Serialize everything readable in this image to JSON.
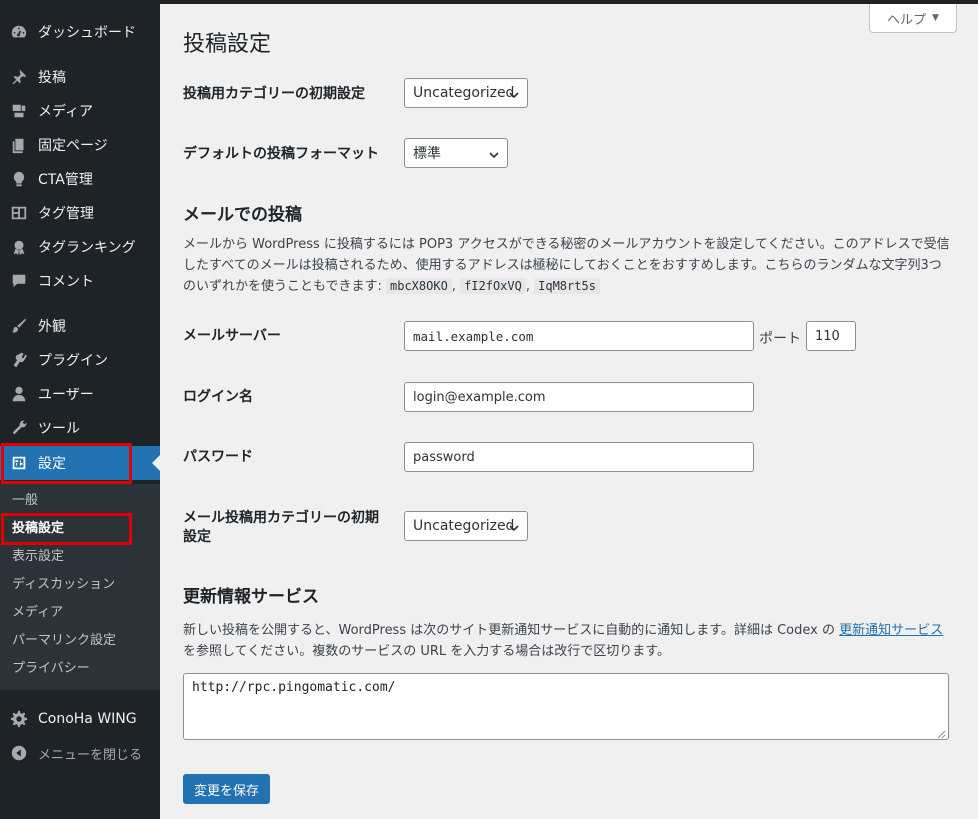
{
  "sidebar": {
    "items": [
      {
        "label": "ダッシュボード",
        "icon": "dashboard-icon"
      },
      {
        "label": "投稿",
        "icon": "pin-icon"
      },
      {
        "label": "メディア",
        "icon": "media-icon"
      },
      {
        "label": "固定ページ",
        "icon": "page-icon"
      },
      {
        "label": "CTA管理",
        "icon": "lightbulb-icon"
      },
      {
        "label": "タグ管理",
        "icon": "layout-icon"
      },
      {
        "label": "タグランキング",
        "icon": "award-icon"
      },
      {
        "label": "コメント",
        "icon": "comment-icon"
      },
      {
        "label": "外観",
        "icon": "brush-icon"
      },
      {
        "label": "プラグイン",
        "icon": "plugin-icon"
      },
      {
        "label": "ユーザー",
        "icon": "user-icon"
      },
      {
        "label": "ツール",
        "icon": "wrench-icon"
      },
      {
        "label": "設定",
        "icon": "settings-icon"
      }
    ],
    "submenu": [
      "一般",
      "投稿設定",
      "表示設定",
      "ディスカッション",
      "メディア",
      "パーマリンク設定",
      "プライバシー"
    ],
    "conoha": "ConoHa WING",
    "collapse": "メニューを閉じる"
  },
  "help": {
    "label": "ヘルプ"
  },
  "page_title": "投稿設定",
  "fields": {
    "default_category_label": "投稿用カテゴリーの初期設定",
    "default_category_value": "Uncategorized",
    "default_format_label": "デフォルトの投稿フォーマット",
    "default_format_value": "標準"
  },
  "mail": {
    "heading": "メールでの投稿",
    "desc_1": "メールから WordPress に投稿するには POP3 アクセスができる秘密のメールアカウントを設定してください。このアドレスで受信したすべてのメールは投稿されるため、使用するアドレスは極秘にしておくことをおすすめします。こちらのランダムな文字列3つのいずれかを使うこともできます: ",
    "codes": [
      "mbcX8OKO",
      "fI2fOxVQ",
      "IqM8rt5s"
    ],
    "sep": ", ",
    "server_label": "メールサーバー",
    "server_value": "mail.example.com",
    "port_label": "ポート",
    "port_value": "110",
    "login_label": "ログイン名",
    "login_value": "login@example.com",
    "password_label": "パスワード",
    "password_value": "password",
    "category_label_1": "メール投稿用カテゴリーの初期",
    "category_label_2": "設定",
    "category_value": "Uncategorized"
  },
  "update": {
    "heading": "更新情報サービス",
    "desc_before": "新しい投稿を公開すると、WordPress は次のサイト更新通知サービスに自動的に通知します。詳細は Codex の ",
    "link": "更新通知サービス",
    "desc_after": " を参照してください。複数のサービスの URL を入力する場合は改行で区切ります。",
    "services": "http://rpc.pingomatic.com/"
  },
  "save_label": "変更を保存",
  "colors": {
    "sidebar_bg": "#1d2327",
    "accent": "#2271b1",
    "highlight": "#e00000"
  }
}
